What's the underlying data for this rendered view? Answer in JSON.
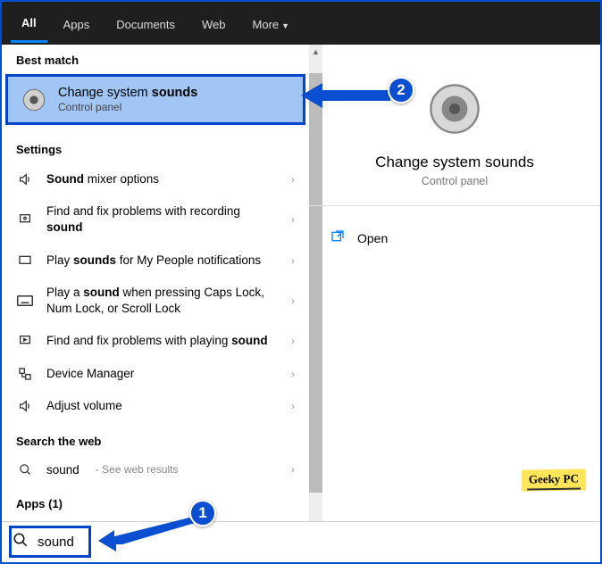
{
  "tabs": {
    "all": "All",
    "apps": "Apps",
    "documents": "Documents",
    "web": "Web",
    "more": "More"
  },
  "labels": {
    "bestMatch": "Best match",
    "settings": "Settings",
    "searchWeb": "Search the web",
    "apps": "Apps (1)"
  },
  "bestMatch": {
    "title_pre": "Change system ",
    "title_bold": "sounds",
    "subtitle": "Control panel"
  },
  "settingsItems": [
    {
      "pre": "",
      "bold": "Sound",
      "post": " mixer options"
    },
    {
      "pre": "Find and fix problems with recording ",
      "bold": "sound",
      "post": ""
    },
    {
      "pre": "Play ",
      "bold": "sounds",
      "post": " for My People notifications"
    },
    {
      "pre": "Play a ",
      "bold": "sound",
      "post": " when pressing Caps Lock, Num Lock, or Scroll Lock"
    },
    {
      "pre": "Find and fix problems with playing ",
      "bold": "sound",
      "post": ""
    },
    {
      "pre": "",
      "bold": "",
      "post": "Device Manager"
    },
    {
      "pre": "",
      "bold": "",
      "post": "Adjust volume"
    }
  ],
  "webItem": {
    "term": "sound",
    "hint": "See web results"
  },
  "rightPane": {
    "title": "Change system sounds",
    "subtitle": "Control panel",
    "open": "Open"
  },
  "search": {
    "value": "sound"
  },
  "watermark": "Geeky PC",
  "annotations": {
    "badge1": "1",
    "badge2": "2"
  }
}
